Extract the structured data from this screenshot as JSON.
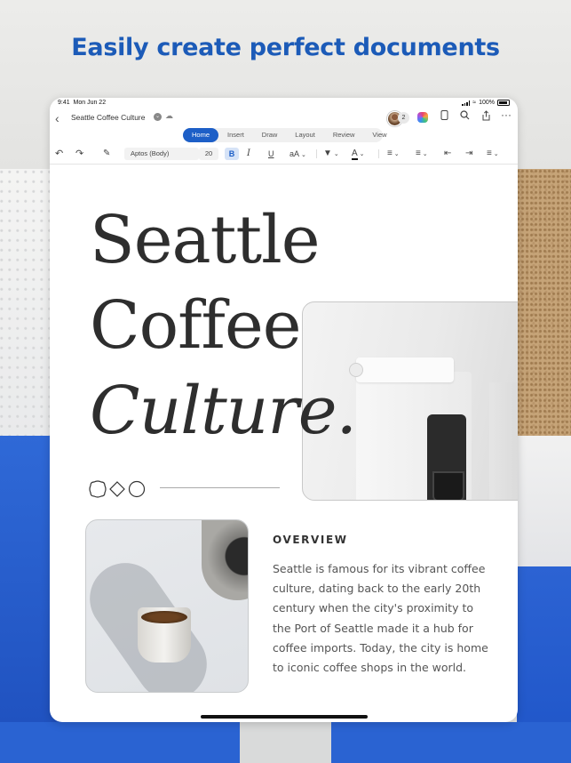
{
  "headline": "Easily create perfect documents",
  "status": {
    "time": "9:41",
    "date": "Mon Jun 22",
    "battery": "100%"
  },
  "titlebar": {
    "back_icon": "chevron-left-icon",
    "doc_title": "Seattle Coffee Culture",
    "collaborator_count": "2",
    "icons": [
      "copilot-icon",
      "phone-view-icon",
      "search-icon",
      "share-icon",
      "more-icon"
    ]
  },
  "tabs": [
    {
      "label": "Home",
      "active": true
    },
    {
      "label": "Insert",
      "active": false
    },
    {
      "label": "Draw",
      "active": false
    },
    {
      "label": "Layout",
      "active": false
    },
    {
      "label": "Review",
      "active": false
    },
    {
      "label": "View",
      "active": false
    }
  ],
  "ribbon": {
    "font_name": "Aptos (Body)",
    "font_size": "20",
    "bold": "B",
    "italic": "I",
    "underline": "U",
    "text_size_label": "aA"
  },
  "document": {
    "title_line1": "Seattle",
    "title_line2": "Coffee",
    "title_line3": "Culture.",
    "overview_heading": "OVERVIEW",
    "overview_body": "Seattle is famous for its vibrant coffee culture, dating back to the early 20th century when the city's proximity to the Port of Seattle made it a hub for coffee imports. Today, the city is home to iconic coffee shops in the world."
  },
  "colors": {
    "accent": "#1d5fc7",
    "headline": "#1c5bb8",
    "title_text": "#2e2e2e"
  }
}
